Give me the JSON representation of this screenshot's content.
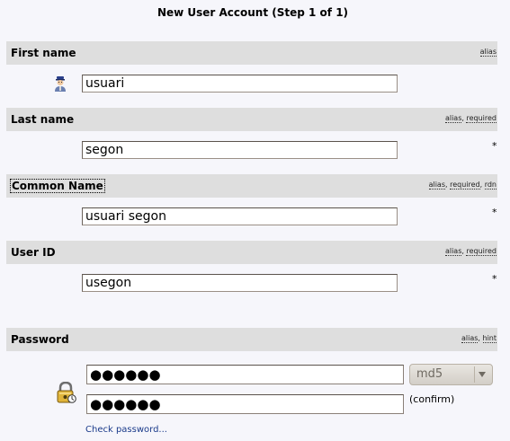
{
  "page": {
    "title": "New User Account (Step 1 of 1)"
  },
  "sections": {
    "first_name": {
      "label": "First name",
      "tags": [
        "alias"
      ],
      "value": "usuari",
      "icon": "user-icon"
    },
    "last_name": {
      "label": "Last name",
      "tags": [
        "alias",
        "required"
      ],
      "value": "segon",
      "required_marker": "*"
    },
    "common_name": {
      "label": "Common Name",
      "tags": [
        "alias",
        "required",
        "rdn"
      ],
      "value": "usuari segon",
      "required_marker": "*"
    },
    "user_id": {
      "label": "User ID",
      "tags": [
        "alias",
        "required"
      ],
      "value": "usegon",
      "required_marker": "*"
    },
    "password": {
      "label": "Password",
      "tags": [
        "alias",
        "hint"
      ],
      "masked_value": "●●●●●●",
      "confirm_masked_value": "●●●●●●",
      "hash_selected": "md5",
      "confirm_label": "(confirm)",
      "check_link": "Check password...",
      "icon": "lock-icon"
    }
  },
  "colors": {
    "background": "#f6f6fb",
    "section_header": "#dedede",
    "link": "#1a3a8a"
  }
}
